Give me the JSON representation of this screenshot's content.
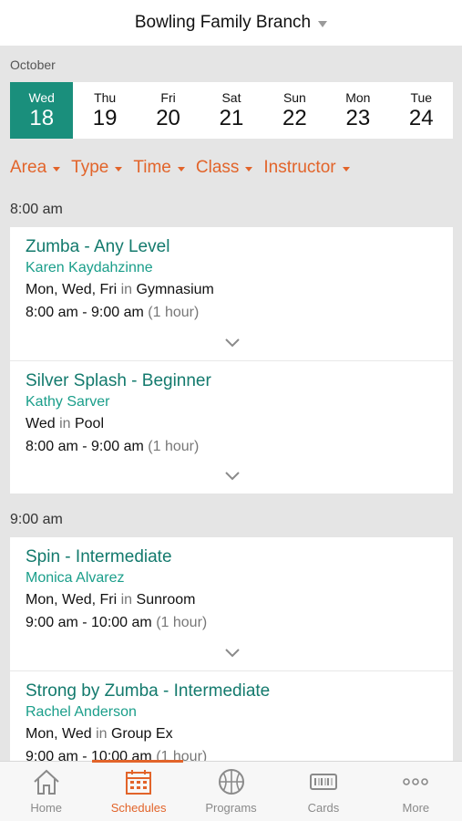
{
  "header": {
    "title": "Bowling Family Branch"
  },
  "month": "October",
  "days": [
    {
      "dow": "Wed",
      "num": "18",
      "selected": true
    },
    {
      "dow": "Thu",
      "num": "19"
    },
    {
      "dow": "Fri",
      "num": "20"
    },
    {
      "dow": "Sat",
      "num": "21"
    },
    {
      "dow": "Sun",
      "num": "22"
    },
    {
      "dow": "Mon",
      "num": "23"
    },
    {
      "dow": "Tue",
      "num": "24"
    }
  ],
  "filters": [
    "Area",
    "Type",
    "Time",
    "Class",
    "Instructor"
  ],
  "groups": [
    {
      "time": "8:00 am",
      "items": [
        {
          "cls": "Zumba - Any Level",
          "instructor": "Karen Kaydahzinne",
          "days": "Mon, Wed, Fri",
          "in": "in",
          "location": "Gymnasium",
          "hours": "8:00 am - 9:00 am",
          "duration": "(1 hour)"
        },
        {
          "cls": "Silver Splash - Beginner",
          "instructor": "Kathy Sarver",
          "days": "Wed",
          "in": "in",
          "location": "Pool",
          "hours": "8:00 am - 9:00 am",
          "duration": "(1 hour)"
        }
      ]
    },
    {
      "time": "9:00 am",
      "items": [
        {
          "cls": "Spin - Intermediate",
          "instructor": "Monica Alvarez",
          "days": "Mon, Wed, Fri",
          "in": "in",
          "location": "Sunroom",
          "hours": "9:00 am - 10:00 am",
          "duration": "(1 hour)"
        },
        {
          "cls": "Strong by Zumba - Intermediate",
          "instructor": "Rachel Anderson",
          "days": "Mon, Wed",
          "in": "in",
          "location": "Group Ex",
          "hours": "9:00 am - 10:00 am",
          "duration": "(1 hour)"
        }
      ]
    }
  ],
  "tabs": [
    {
      "label": "Home",
      "icon": "home-icon"
    },
    {
      "label": "Schedules",
      "icon": "calendar-icon",
      "active": true
    },
    {
      "label": "Programs",
      "icon": "basketball-icon"
    },
    {
      "label": "Cards",
      "icon": "barcode-card-icon"
    },
    {
      "label": "More",
      "icon": "more-dots-icon"
    }
  ],
  "colors": {
    "accent": "#e2642a",
    "teal": "#1a8f7c",
    "instructor": "#1a9e8a"
  }
}
